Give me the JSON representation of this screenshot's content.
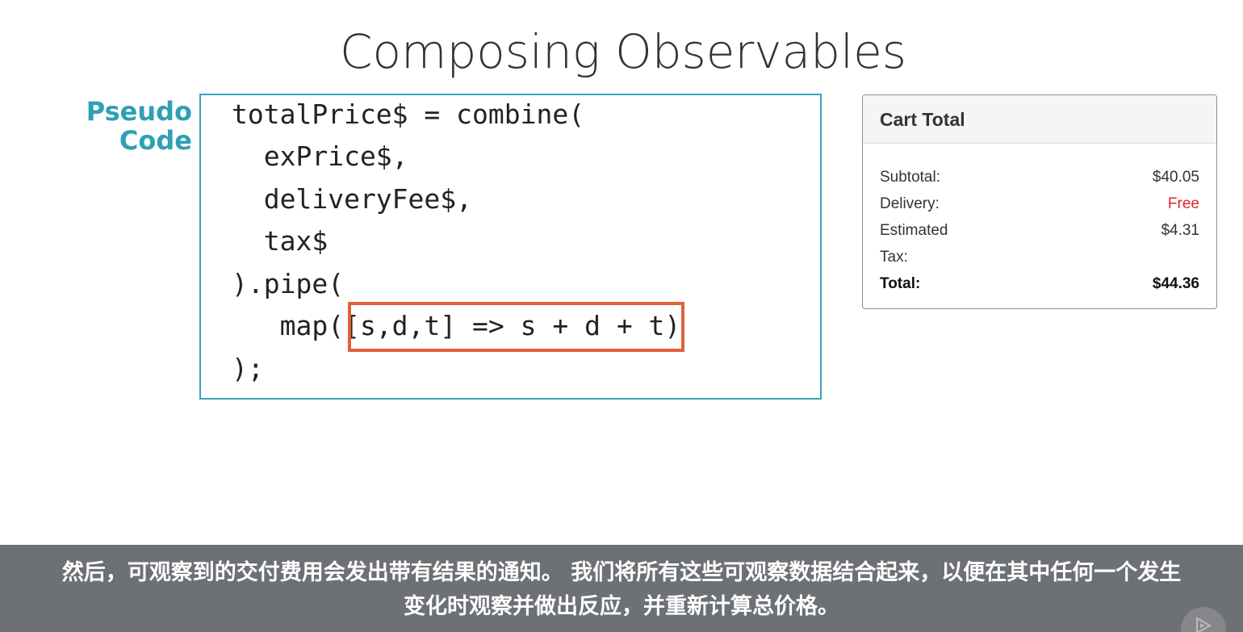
{
  "slide": {
    "title": "Composing Observables",
    "label_line1": "Pseudo",
    "label_line2": "Code"
  },
  "code": {
    "lines": [
      "totalPrice$ = combine(",
      "  exPrice$,",
      "  deliveryFee$,",
      "  tax$",
      ").pipe(",
      "   map([s,d,t] => s + d + t)",
      ");"
    ],
    "highlighted_fragment": "[s,d,t] => s + d + t"
  },
  "cart": {
    "title": "Cart Total",
    "rows": [
      {
        "label": "Subtotal:",
        "value": "$40.05"
      },
      {
        "label": "Delivery:",
        "value": "Free"
      },
      {
        "label": "Estimated Tax:",
        "value": "$4.31"
      },
      {
        "label": "Total:",
        "value": "$44.36"
      }
    ]
  },
  "subtitle": {
    "line1": "然后，可观察到的交付费用会发出带有结果的通知。 我们将所有这些可观察数据结合起来，以便在其中任何一个发生",
    "line2": "变化时观察并做出反应，并重新计算总价格。"
  },
  "icons": {
    "player": "play-icon"
  },
  "colors": {
    "accent": "#2fa0b4",
    "code_border": "#3ea0bb",
    "highlight": "#e2603a",
    "free": "#d9262c",
    "subtitle_bg": "#6d7074"
  }
}
